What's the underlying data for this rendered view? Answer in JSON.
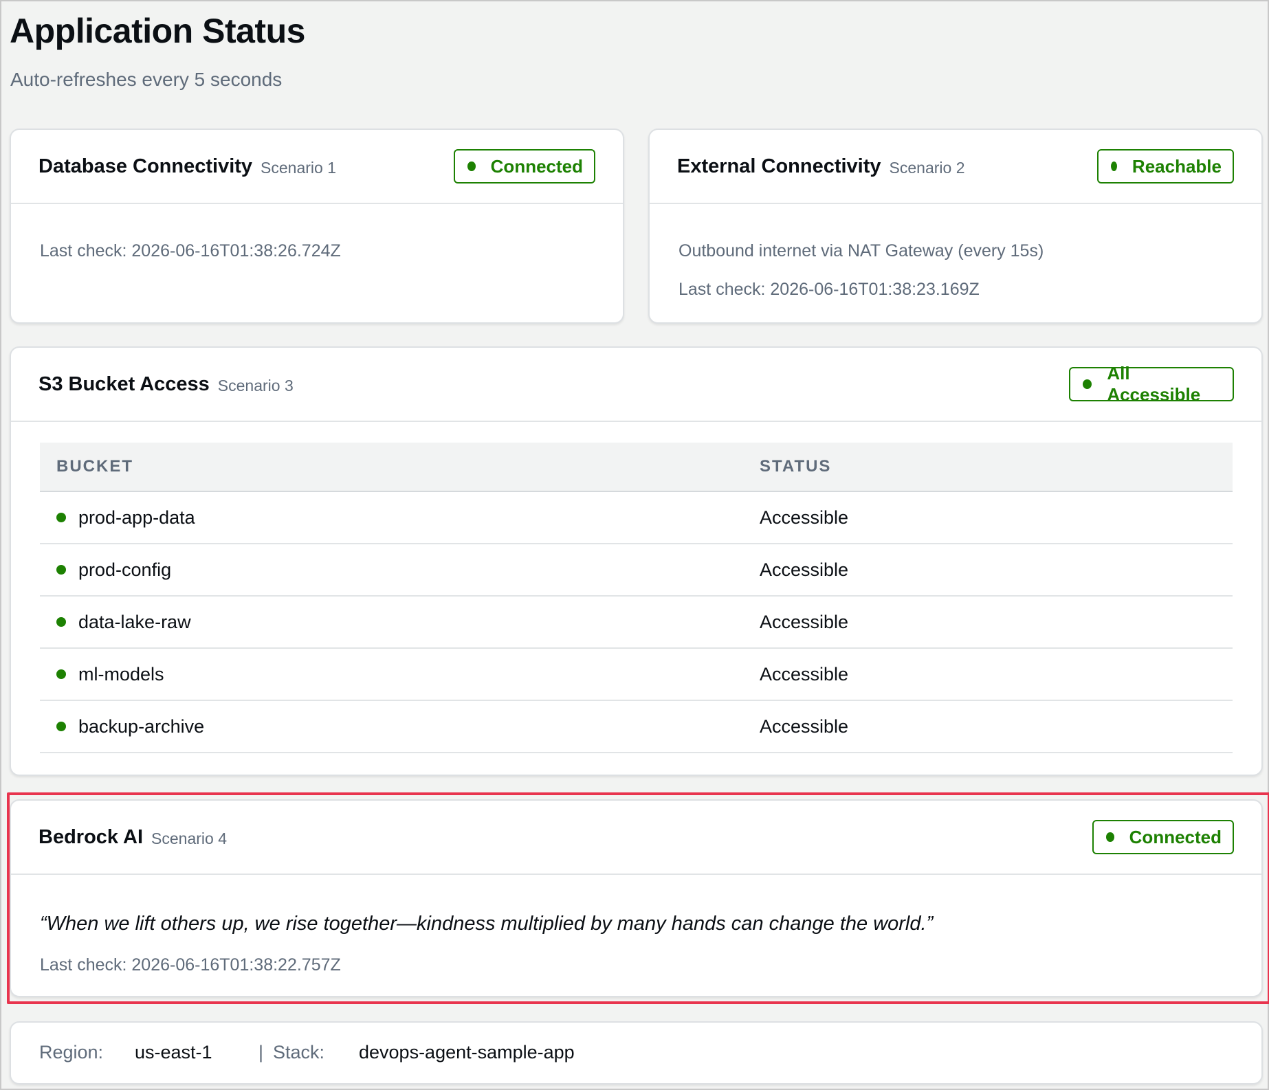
{
  "page": {
    "title": "Application Status",
    "subtitle": "Auto-refreshes every 5 seconds"
  },
  "colors": {
    "success": "#1d8102",
    "highlight_border": "#e8344e",
    "background": "#f2f3f2"
  },
  "database": {
    "title": "Database Connectivity",
    "scenario": "Scenario 1",
    "status": "Connected",
    "last_check": "Last check: 2026-06-16T01:38:26.724Z"
  },
  "external": {
    "title": "External Connectivity",
    "scenario": "Scenario 2",
    "status": "Reachable",
    "description": "Outbound internet via NAT Gateway (every 15s)",
    "last_check": "Last check: 2026-06-16T01:38:23.169Z"
  },
  "s3": {
    "title": "S3 Bucket Access",
    "scenario": "Scenario 3",
    "status": "All Accessible",
    "columns": [
      "BUCKET",
      "STATUS"
    ],
    "rows": [
      {
        "bucket": "prod-app-data",
        "status": "Accessible"
      },
      {
        "bucket": "prod-config",
        "status": "Accessible"
      },
      {
        "bucket": "data-lake-raw",
        "status": "Accessible"
      },
      {
        "bucket": "ml-models",
        "status": "Accessible"
      },
      {
        "bucket": "backup-archive",
        "status": "Accessible"
      }
    ]
  },
  "bedrock": {
    "title": "Bedrock AI",
    "scenario": "Scenario 4",
    "status": "Connected",
    "quote": "“When we lift others up, we rise together—kindness multiplied by many hands can change the world.”",
    "last_check": "Last check: 2026-06-16T01:38:22.757Z"
  },
  "footer": {
    "region_label": "Region:",
    "region_value": "us-east-1",
    "separator": "|",
    "stack_label": "Stack:",
    "stack_value": "devops-agent-sample-app"
  }
}
